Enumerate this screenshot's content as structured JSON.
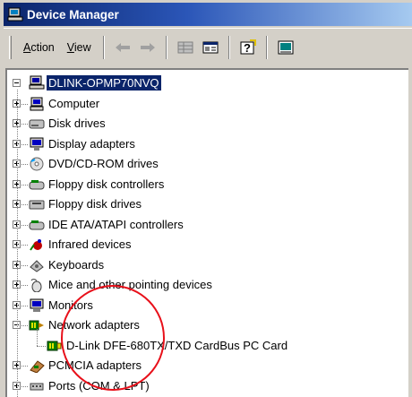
{
  "window": {
    "title": "Device Manager"
  },
  "menu": {
    "action": "Action",
    "action_ul": "A",
    "action_rest": "ction",
    "view": "View",
    "view_ul": "V",
    "view_rest": "iew"
  },
  "toolbar": {
    "buttons": [
      {
        "icon": "back-arrow-icon"
      },
      {
        "icon": "forward-arrow-icon"
      },
      {
        "icon": "grid-view-icon"
      },
      {
        "icon": "properties-icon"
      },
      {
        "icon": "help-icon"
      },
      {
        "icon": "scan-hardware-icon"
      }
    ]
  },
  "tree": {
    "root": "DLINK-OPMP70NVQ",
    "items": [
      {
        "label": "Computer",
        "icon": "computer-icon",
        "expanded": false
      },
      {
        "label": "Disk drives",
        "icon": "disk-drive-icon",
        "expanded": false
      },
      {
        "label": "Display adapters",
        "icon": "display-adapter-icon",
        "expanded": false
      },
      {
        "label": "DVD/CD-ROM drives",
        "icon": "cdrom-icon",
        "expanded": false
      },
      {
        "label": "Floppy disk controllers",
        "icon": "floppy-controller-icon",
        "expanded": false
      },
      {
        "label": "Floppy disk drives",
        "icon": "floppy-drive-icon",
        "expanded": false
      },
      {
        "label": "IDE ATA/ATAPI controllers",
        "icon": "ide-controller-icon",
        "expanded": false
      },
      {
        "label": "Infrared devices",
        "icon": "infrared-icon",
        "expanded": false
      },
      {
        "label": "Keyboards",
        "icon": "keyboard-icon",
        "expanded": false
      },
      {
        "label": "Mice and other pointing devices",
        "icon": "mouse-icon",
        "expanded": false
      },
      {
        "label": "Monitors",
        "icon": "monitor-icon",
        "expanded": false
      },
      {
        "label": "Network adapters",
        "icon": "network-adapter-icon",
        "expanded": true,
        "children": [
          {
            "label": "D-Link DFE-680TX/TXD CardBus PC Card",
            "icon": "network-card-icon"
          }
        ]
      },
      {
        "label": "PCMCIA adapters",
        "icon": "pcmcia-icon",
        "expanded": false
      },
      {
        "label": "Ports (COM & LPT)",
        "icon": "ports-icon",
        "expanded": false
      }
    ]
  },
  "colors": {
    "title_start": "#0a246a",
    "title_end": "#a6caf0",
    "annotation": "#e8101a"
  }
}
